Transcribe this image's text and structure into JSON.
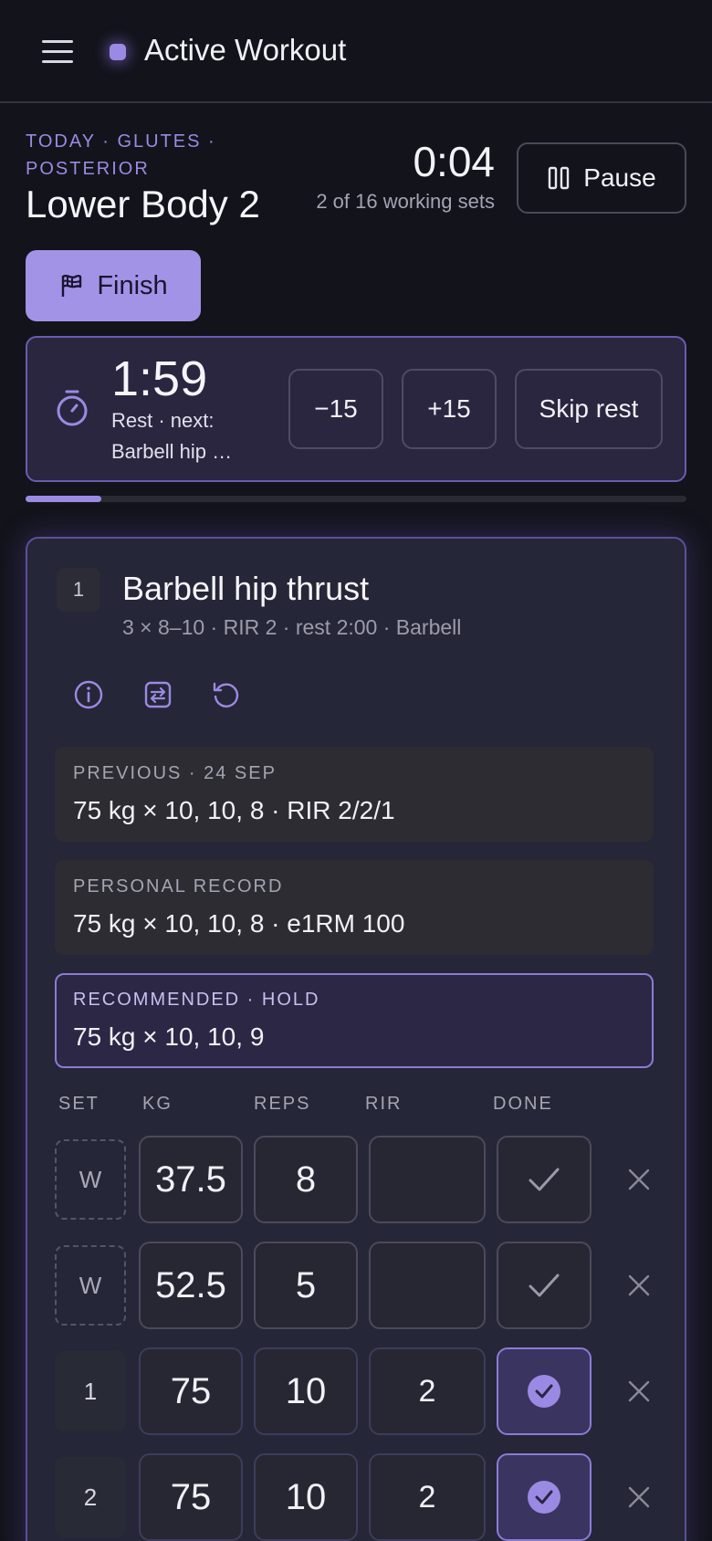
{
  "header": {
    "title": "Active Workout"
  },
  "session": {
    "crumb": "TODAY · GLUTES · POSTERIOR",
    "name": "Lower Body 2",
    "elapsed": "0:04",
    "sets_progress": "2 of 16 working sets",
    "pause_label": "Pause",
    "finish_label": "Finish"
  },
  "rest": {
    "time": "1:59",
    "next": "Rest · next: Barbell hip …",
    "minus_label": "−15",
    "plus_label": "+15",
    "skip_label": "Skip rest",
    "progress": 0.115
  },
  "exercise": {
    "number": "1",
    "name": "Barbell hip thrust",
    "meta": "3 × 8–10 · RIR 2 · rest 2:00 · Barbell",
    "icons": [
      "info-icon",
      "swap-icon",
      "undo-icon"
    ],
    "previous": {
      "label": "PREVIOUS · 24 SEP",
      "value": "75 kg × 10, 10, 8 · RIR 2/2/1"
    },
    "record": {
      "label": "PERSONAL RECORD",
      "value": "75 kg × 10, 10, 8 · e1RM 100"
    },
    "recommended": {
      "label": "RECOMMENDED · HOLD",
      "value": "75 kg × 10, 10, 9"
    },
    "columns": {
      "set": "SET",
      "kg": "KG",
      "reps": "REPS",
      "rir": "RIR",
      "done": "DONE"
    },
    "sets": [
      {
        "label": "W",
        "kg": "37.5",
        "reps": "8",
        "rir": "",
        "done": false,
        "type": "warmup"
      },
      {
        "label": "W",
        "kg": "52.5",
        "reps": "5",
        "rir": "",
        "done": false,
        "type": "warmup"
      },
      {
        "label": "1",
        "kg": "75",
        "reps": "10",
        "rir": "2",
        "done": true,
        "type": "working"
      },
      {
        "label": "2",
        "kg": "75",
        "reps": "10",
        "rir": "2",
        "done": true,
        "type": "working"
      }
    ]
  },
  "colors": {
    "accent": "#9b8ae3",
    "background": "#13131b",
    "card": "#252637"
  }
}
